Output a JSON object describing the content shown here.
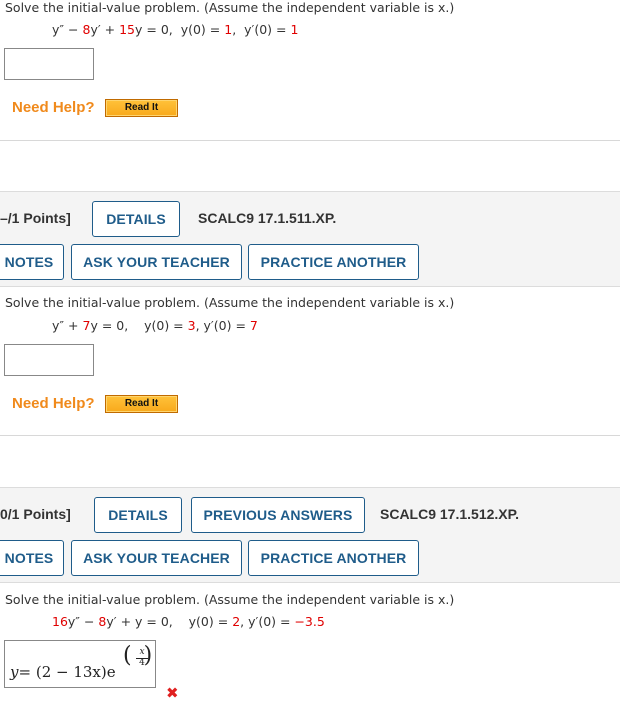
{
  "questions": [
    {
      "prompt": "Solve the initial-value problem. (Assume the independent variable is x.)",
      "equation": {
        "parts": [
          {
            "t": "y″ − ",
            "red": false
          },
          {
            "t": "8",
            "red": true
          },
          {
            "t": "y′ + ",
            "red": false
          },
          {
            "t": "15",
            "red": true
          },
          {
            "t": "y = 0,  y(0) = ",
            "red": false
          },
          {
            "t": "1",
            "red": true
          },
          {
            "t": ",  y′(0) = ",
            "red": false
          },
          {
            "t": "1",
            "red": true
          }
        ]
      },
      "answer_value": "",
      "need_help_label": "Need Help?",
      "read_it_label": "Read It"
    },
    {
      "points_label": "–/1 Points]",
      "details_label": "DETAILS",
      "code": "SCALC9 17.1.511.XP.",
      "notes_label": "NOTES",
      "ask_teacher_label": "ASK YOUR TEACHER",
      "practice_another_label": "PRACTICE ANOTHER",
      "prompt": "Solve the initial-value problem. (Assume the independent variable is x.)",
      "equation": {
        "parts": [
          {
            "t": "y″ + ",
            "red": false
          },
          {
            "t": "7",
            "red": true
          },
          {
            "t": "y = 0,    y(0) = ",
            "red": false
          },
          {
            "t": "3",
            "red": true
          },
          {
            "t": ", y′(0) = ",
            "red": false
          },
          {
            "t": "7",
            "red": true
          }
        ]
      },
      "answer_value": "",
      "need_help_label": "Need Help?",
      "read_it_label": "Read It"
    },
    {
      "points_label": "0/1 Points]",
      "details_label": "DETAILS",
      "previous_answers_label": "PREVIOUS ANSWERS",
      "code": "SCALC9 17.1.512.XP.",
      "notes_label": "NOTES",
      "ask_teacher_label": "ASK YOUR TEACHER",
      "practice_another_label": "PRACTICE ANOTHER",
      "prompt": "Solve the initial-value problem. (Assume the independent variable is x.)",
      "equation": {
        "parts": [
          {
            "t": "16",
            "red": true
          },
          {
            "t": "y″ − ",
            "red": false
          },
          {
            "t": "8",
            "red": true
          },
          {
            "t": "y′ + y = 0,    y(0) = ",
            "red": false
          },
          {
            "t": "2",
            "red": true
          },
          {
            "t": ", y′(0) = ",
            "red": false
          },
          {
            "t": "−3.5",
            "red": true
          }
        ]
      },
      "answer": {
        "lhs": "y",
        "equals": "=",
        "body": "(2 − 13x)e",
        "exp_open": "(",
        "exp_num": "x",
        "exp_den": "4",
        "exp_close": ")",
        "status": "incorrect",
        "status_icon": "x-mark-icon",
        "status_glyph": "✖"
      }
    }
  ],
  "colors": {
    "accent_blue": "#1f5c8a",
    "need_help_orange": "#f08a1c",
    "red_values": "#e00000",
    "incorrect_red": "#e02020"
  }
}
